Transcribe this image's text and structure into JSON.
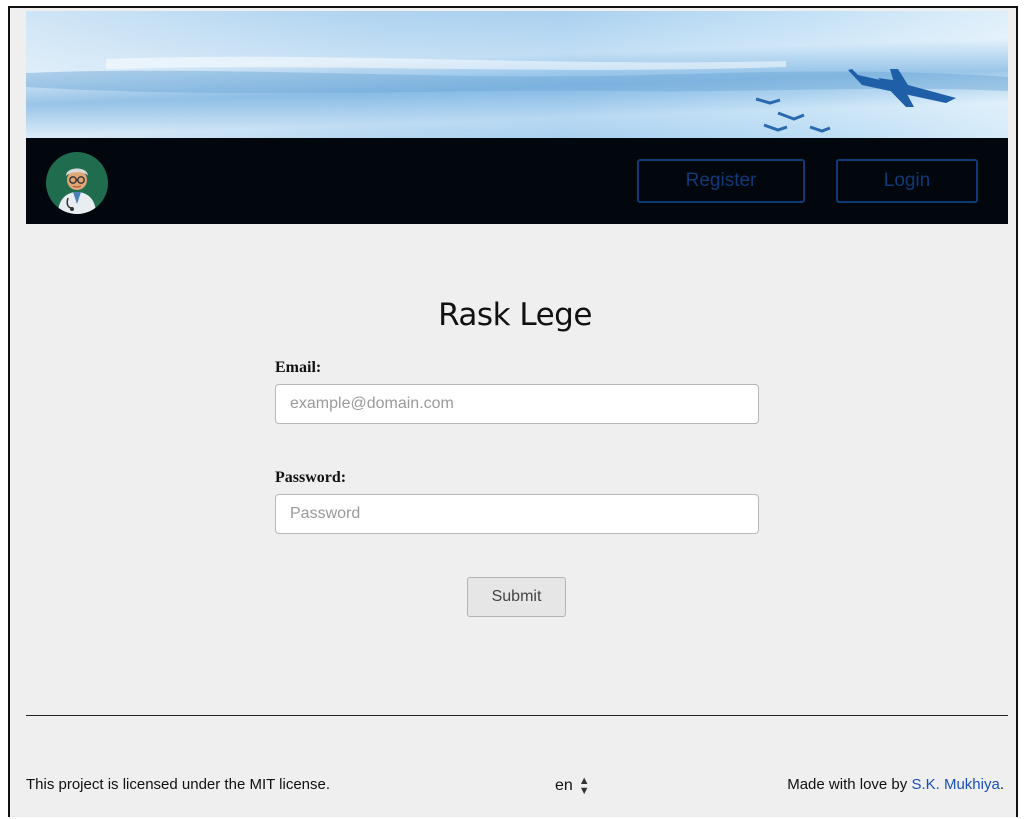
{
  "header": {
    "register_label": "Register",
    "login_label": "Login"
  },
  "main": {
    "title": "Rask Lege",
    "email": {
      "label": "Email:",
      "placeholder": "example@domain.com",
      "value": ""
    },
    "password": {
      "label": "Password:",
      "placeholder": "Password",
      "value": ""
    },
    "submit_label": "Submit"
  },
  "footer": {
    "license_text": "This project is licensed under the MIT license.",
    "language": "en",
    "made_with_prefix": "Made with love by ",
    "author_name": "S.K. Mukhiya",
    "made_with_suffix": "."
  },
  "icons": {
    "avatar": "doctor-avatar-icon",
    "hero_plane": "airplane-icon",
    "language_toggle": "up-down-arrows-icon"
  },
  "colors": {
    "navbar_bg": "#02060d",
    "nav_button": "#0f3a78",
    "link": "#1a4fb8",
    "page_bg": "#efefef"
  }
}
